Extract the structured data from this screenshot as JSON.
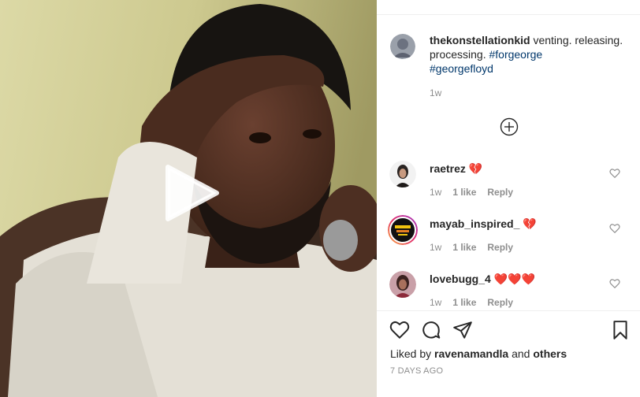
{
  "post": {
    "username": "thekonstellationkid",
    "caption_text": " venting. releasing. processing. ",
    "hashtags": [
      "#forgeorge",
      "#georgefloyd"
    ],
    "time_ago": "1w"
  },
  "comments": [
    {
      "username": "raetrez",
      "text": "💔",
      "time": "1w",
      "likes": "1 like",
      "reply": "Reply"
    },
    {
      "username": "mayab_inspired_",
      "text": "💔",
      "time": "1w",
      "likes": "1 like",
      "reply": "Reply"
    },
    {
      "username": "lovebugg_4",
      "text": "❤️❤️❤️",
      "time": "1w",
      "likes": "1 like",
      "reply": "Reply"
    }
  ],
  "likes": {
    "prefix": "Liked by ",
    "user": "ravenamandla",
    "middle": " and ",
    "others": "others"
  },
  "posted_date": "7 DAYS AGO",
  "colors": {
    "text": "#262626",
    "muted": "#8e8e8e",
    "link": "#00376b",
    "broken_heart": "#e0245e"
  }
}
